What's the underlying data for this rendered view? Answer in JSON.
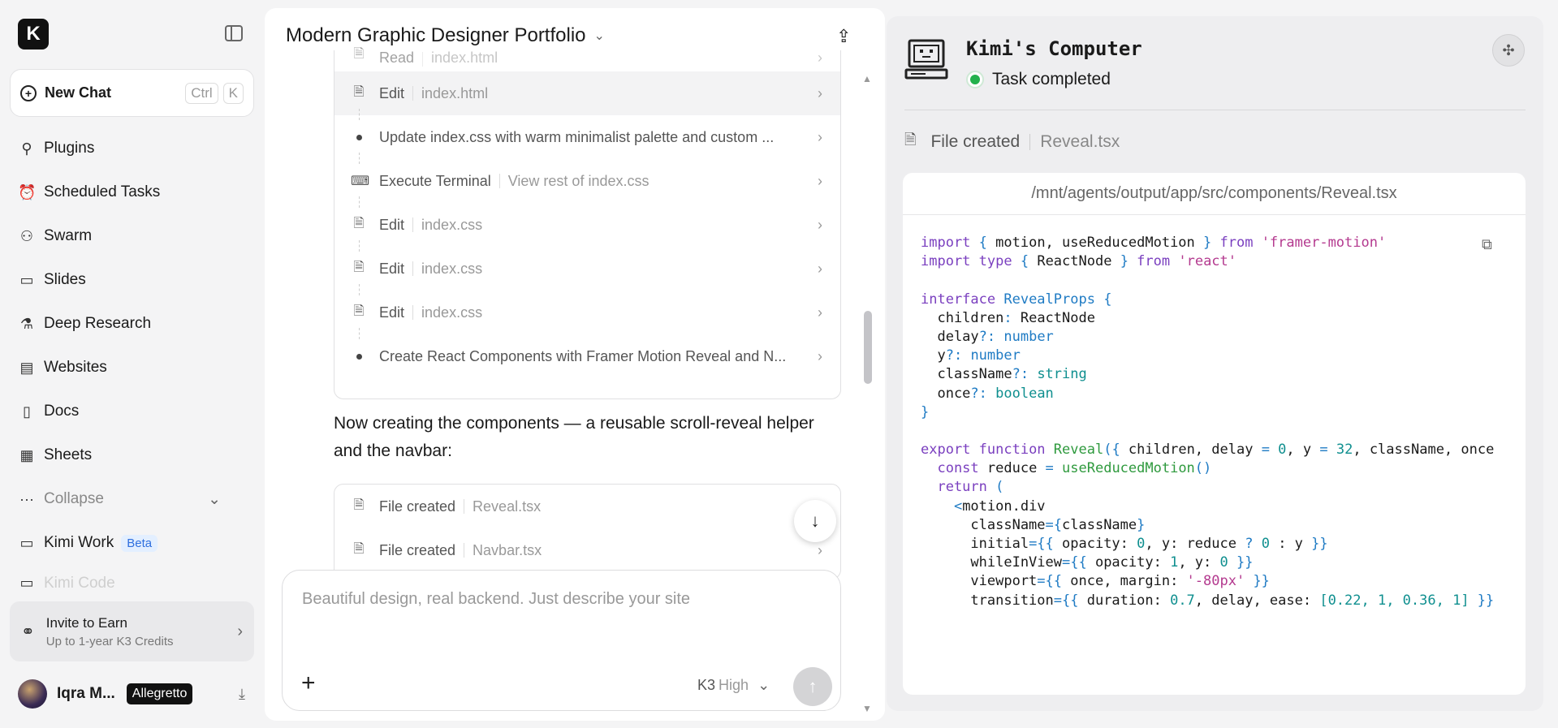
{
  "sidebar": {
    "logo": "K",
    "new_chat": {
      "label": "New Chat",
      "kbd1": "Ctrl",
      "kbd2": "K"
    },
    "items": [
      {
        "label": "Plugins",
        "icon": "plug-icon"
      },
      {
        "label": "Scheduled Tasks",
        "icon": "alarm-icon"
      },
      {
        "label": "Swarm",
        "icon": "swarm-icon"
      },
      {
        "label": "Slides",
        "icon": "presentation-icon"
      },
      {
        "label": "Deep Research",
        "icon": "research-icon"
      },
      {
        "label": "Websites",
        "icon": "browser-icon"
      },
      {
        "label": "Docs",
        "icon": "doc-icon"
      },
      {
        "label": "Sheets",
        "icon": "table-icon"
      }
    ],
    "collapse": "Collapse",
    "kimi_work": {
      "label": "Kimi Work",
      "badge": "Beta"
    },
    "kimi_code": "Kimi Code",
    "invite": {
      "title": "Invite to Earn",
      "subtitle": "Up to 1-year K3 Credits"
    },
    "user": {
      "name": "Iqra M...",
      "plan": "Allegretto"
    }
  },
  "chat": {
    "title": "Modern Graphic Designer Portfolio",
    "steps": [
      {
        "action": "Read",
        "target": "index.html",
        "type": "file"
      },
      {
        "action": "Edit",
        "target": "index.html",
        "type": "file"
      },
      {
        "action": "Update index.css with warm minimalist palette and custom ...",
        "target": "",
        "type": "bullet"
      },
      {
        "action": "Execute Terminal",
        "target": "View rest of index.css",
        "type": "terminal"
      },
      {
        "action": "Edit",
        "target": "index.css",
        "type": "file"
      },
      {
        "action": "Edit",
        "target": "index.css",
        "type": "file"
      },
      {
        "action": "Edit",
        "target": "index.css",
        "type": "file"
      },
      {
        "action": "Create React Components with Framer Motion Reveal and N...",
        "target": "",
        "type": "bullet"
      }
    ],
    "message": "Now creating the components — a reusable scroll-reveal helper and the navbar:",
    "files": [
      {
        "action": "File created",
        "target": "Reveal.tsx"
      },
      {
        "action": "File created",
        "target": "Navbar.tsx"
      }
    ],
    "composer": {
      "placeholder": "Beautiful design, real backend. Just describe your site",
      "model": "K3",
      "level": "High"
    }
  },
  "computer": {
    "title": "Kimi's Computer",
    "status": "Task completed",
    "file_action": "File created",
    "file_name": "Reveal.tsx",
    "path": "/mnt/agents/output/app/src/components/Reveal.tsx",
    "colors": {
      "keyword": "#7a3fbf",
      "string": "#b43a8f",
      "type": "#1f7bc4",
      "func": "#2f9a3e",
      "number": "#0f8f8f",
      "status": "#22b14c"
    },
    "code_lines": [
      [
        [
          "import ",
          "kw"
        ],
        [
          "{ ",
          "p"
        ],
        [
          "motion, useReducedMotion ",
          ""
        ],
        [
          "} ",
          "p"
        ],
        [
          "from ",
          "kw"
        ],
        [
          "'framer-motion'",
          "str"
        ]
      ],
      [
        [
          "import ",
          "kw"
        ],
        [
          "type ",
          "kw"
        ],
        [
          "{ ",
          "p"
        ],
        [
          "ReactNode ",
          ""
        ],
        [
          "} ",
          "p"
        ],
        [
          "from ",
          "kw"
        ],
        [
          "'react'",
          "str"
        ]
      ],
      [],
      [
        [
          "interface ",
          "kw"
        ],
        [
          "RevealProps ",
          "ty"
        ],
        [
          "{",
          "p"
        ]
      ],
      [
        [
          "  children",
          ""
        ],
        [
          ": ",
          "p"
        ],
        [
          "ReactNode",
          ""
        ]
      ],
      [
        [
          "  delay",
          ""
        ],
        [
          "?: ",
          "p"
        ],
        [
          "number",
          "ty"
        ]
      ],
      [
        [
          "  y",
          ""
        ],
        [
          "?: ",
          "p"
        ],
        [
          "number",
          "ty"
        ]
      ],
      [
        [
          "  className",
          ""
        ],
        [
          "?: ",
          "p"
        ],
        [
          "string",
          "num"
        ]
      ],
      [
        [
          "  once",
          ""
        ],
        [
          "?: ",
          "p"
        ],
        [
          "boolean",
          "num"
        ]
      ],
      [
        [
          "}",
          "p"
        ]
      ],
      [],
      [
        [
          "export ",
          "kw"
        ],
        [
          "function ",
          "kw"
        ],
        [
          "Reveal",
          "fn"
        ],
        [
          "({ ",
          "p"
        ],
        [
          "children, delay ",
          ""
        ],
        [
          "= ",
          "p"
        ],
        [
          "0",
          "num"
        ],
        [
          ", y ",
          ""
        ],
        [
          "= ",
          "p"
        ],
        [
          "32",
          "num"
        ],
        [
          ", className, once",
          ""
        ]
      ],
      [
        [
          "  const ",
          "kw"
        ],
        [
          "reduce ",
          ""
        ],
        [
          "= ",
          "p"
        ],
        [
          "useReducedMotion",
          "fn"
        ],
        [
          "()",
          "p"
        ]
      ],
      [
        [
          "  return ",
          "kw"
        ],
        [
          "(",
          "p"
        ]
      ],
      [
        [
          "    <",
          "p"
        ],
        [
          "motion.div",
          ""
        ]
      ],
      [
        [
          "      className",
          ""
        ],
        [
          "={",
          "p"
        ],
        [
          "className",
          ""
        ],
        [
          "}",
          "p"
        ]
      ],
      [
        [
          "      initial",
          ""
        ],
        [
          "={{ ",
          "p"
        ],
        [
          "opacity: ",
          ""
        ],
        [
          "0",
          "num"
        ],
        [
          ", y: reduce ",
          ""
        ],
        [
          "? ",
          "p"
        ],
        [
          "0 ",
          "num"
        ],
        [
          ": y ",
          ""
        ],
        [
          "}}",
          "p"
        ]
      ],
      [
        [
          "      whileInView",
          ""
        ],
        [
          "={{ ",
          "p"
        ],
        [
          "opacity: ",
          ""
        ],
        [
          "1",
          "num"
        ],
        [
          ", y: ",
          ""
        ],
        [
          "0 ",
          "num"
        ],
        [
          "}}",
          "p"
        ]
      ],
      [
        [
          "      viewport",
          ""
        ],
        [
          "={{ ",
          "p"
        ],
        [
          "once, margin: ",
          ""
        ],
        [
          "'-80px' ",
          "str"
        ],
        [
          "}}",
          "p"
        ]
      ],
      [
        [
          "      transition",
          ""
        ],
        [
          "={{ ",
          "p"
        ],
        [
          "duration: ",
          ""
        ],
        [
          "0.7",
          "num"
        ],
        [
          ", delay, ease: ",
          ""
        ],
        [
          "[0.22, 1, 0.36, 1]",
          "num"
        ],
        [
          " }}",
          "p"
        ]
      ]
    ]
  }
}
